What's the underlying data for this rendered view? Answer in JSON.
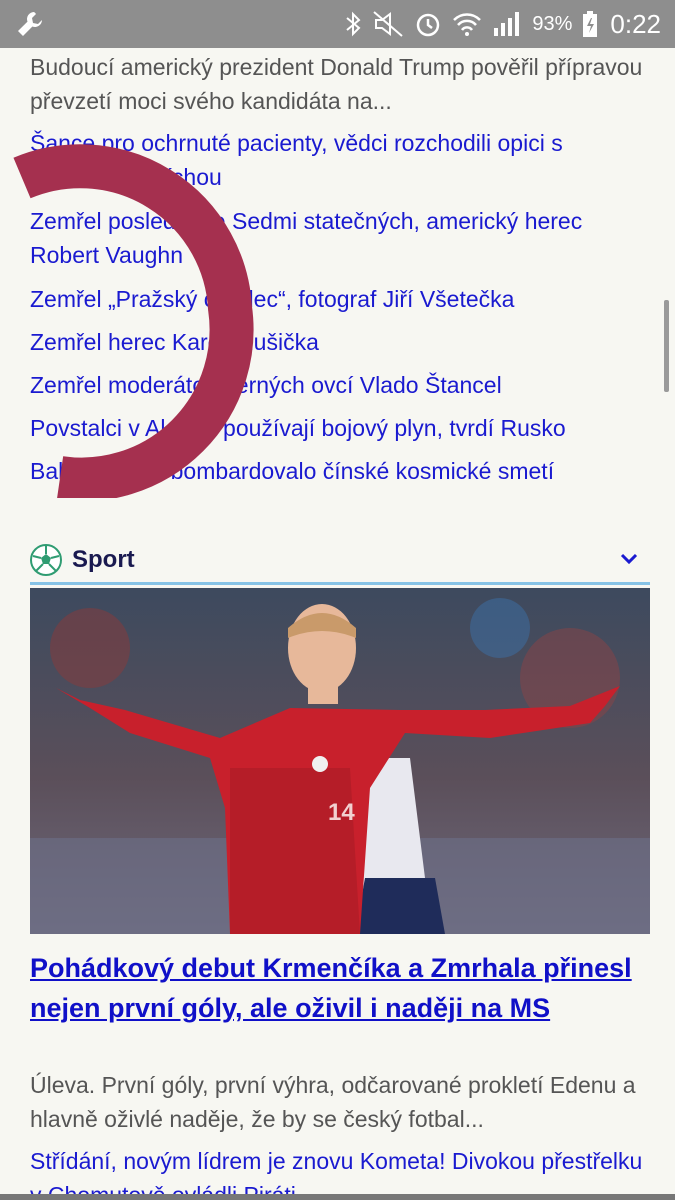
{
  "status_bar": {
    "icons": [
      "wrench-icon",
      "bluetooth-icon",
      "mute-icon",
      "alarm-icon",
      "wifi-icon",
      "signal-icon",
      "battery-icon"
    ],
    "battery": "93%",
    "time": "0:22"
  },
  "news": {
    "description": "Budoucí americký prezident Donald Trump pověřil přípravou převzetí moci svého kandidáta na...",
    "links": [
      "Šance pro ochrnuté pacienty, vědci rozchodili opici s poraněnou míchou",
      "Zemřel poslední ze Sedmi statečných, americký herec Robert Vaughn",
      "Zemřel „Pražský chodec“, fotograf Jiří Všetečka",
      "Zemřel herec Karel Hlušička",
      "Zemřel moderátor Černých ovcí Vlado Štancel",
      "Povstalci v Aleppu používají bojový plyn, tvrdí Rusko",
      "Baltské moře bombardovalo čínské kosmické smetí"
    ]
  },
  "sport": {
    "title": "Sport",
    "headline": "Pohádkový debut Krmenčíka a Zmrhala přinesl nejen první góly, ale oživil i naději na MS",
    "perex": "Úleva. První góly, první výhra, odčarované prokletí Edenu a hlavně oživlé naděje, že by se český fotbal...",
    "next_link": "Střídání, novým lídrem je znovu Kometa! Divokou přestřelku v Chomutově ovládli Piráti",
    "jersey_number": "14"
  },
  "colors": {
    "link": "#1a1ad0",
    "headline": "#1010c8",
    "section_rule": "#86c3e6",
    "logo": "#a5304f",
    "status_bar": "#8e8e8e"
  }
}
